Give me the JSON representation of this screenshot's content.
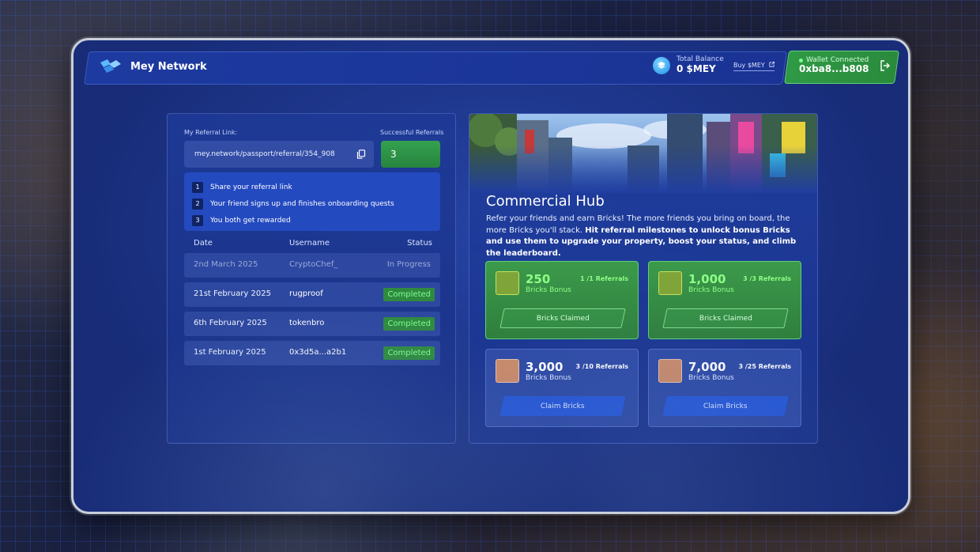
{
  "header": {
    "brand": "Mey Network",
    "balance_label": "Total Balance",
    "balance_value": "0 $MEY",
    "buy_label": "Buy $MEY",
    "wallet_status": "Wallet Connected",
    "wallet_address": "0xba8...b808"
  },
  "referral": {
    "link_label": "My Referral Link:",
    "link_value": "mey.network/passport/referral/354_908",
    "count_label": "Successful Referrals",
    "count_value": "3",
    "steps": [
      {
        "num": "1",
        "text": "Share your referral link"
      },
      {
        "num": "2",
        "text": "Your friend signs up and finishes onboarding quests"
      },
      {
        "num": "3",
        "text": "You both get rewarded"
      }
    ],
    "table": {
      "headers": [
        "Date",
        "Username",
        "Status"
      ],
      "rows": [
        {
          "date": "2nd March 2025",
          "user": "CryptoChef_",
          "status": "In Progress"
        },
        {
          "date": "21st February 2025",
          "user": "rugproof",
          "status": "Completed"
        },
        {
          "date": "6th February 2025",
          "user": "tokenbro",
          "status": "Completed"
        },
        {
          "date": "1st February 2025",
          "user": "0x3d5a...a2b1",
          "status": "Completed"
        }
      ]
    }
  },
  "hub": {
    "title": "Commercial Hub",
    "desc_plain": "Refer your friends and earn Bricks!  The more friends you bring on board, the more Bricks you'll stack. ",
    "desc_bold": "Hit referral milestones to unlock bonus Bricks and use them to upgrade your property, boost your status, and climb the leaderboard.",
    "cards": [
      {
        "amount": "250",
        "sub": "Bricks Bonus",
        "refs": "1 /1 Referrals",
        "button": "Bricks Claimed",
        "state": "claimed"
      },
      {
        "amount": "1,000",
        "sub": "Bricks Bonus",
        "refs": "3 /3 Referrals",
        "button": "Bricks Claimed",
        "state": "claimed"
      },
      {
        "amount": "3,000",
        "sub": "Bricks Bonus",
        "refs": "3 /10 Referrals",
        "button": "Claim Bricks",
        "state": "locked"
      },
      {
        "amount": "7,000",
        "sub": "Bricks Bonus",
        "refs": "3 /25 Referrals",
        "button": "Claim Bricks",
        "state": "locked"
      }
    ]
  },
  "colors": {
    "accent_green": "#2f8a3f",
    "accent_blue": "#2657d4",
    "panel_blue": "#1e3a96"
  }
}
